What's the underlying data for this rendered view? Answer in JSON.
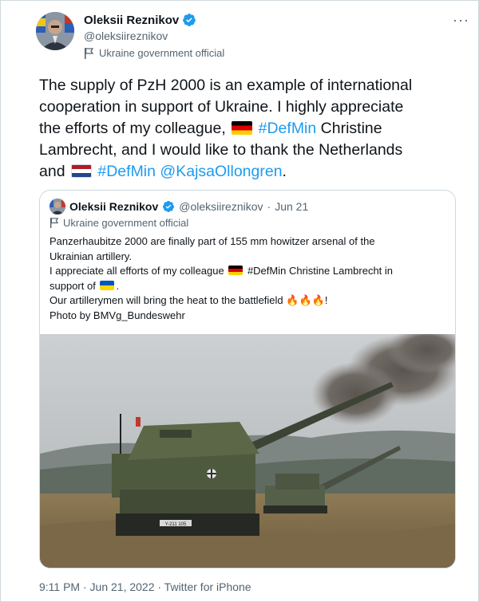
{
  "author": {
    "name": "Oleksii Reznikov",
    "handle": "@oleksiireznikov",
    "label": "Ukraine government official"
  },
  "more_label": "···",
  "tweet": {
    "line1": "The supply of PzH 2000 is an example of international",
    "line2": "cooperation in support of Ukraine. I highly appreciate",
    "line3_pre": "the efforts of my colleague, ",
    "hashtag1": "#DefMin",
    "line3_post": " Christine",
    "line4": "Lambrecht, and I would like to thank the Netherlands",
    "line5_pre": "and ",
    "hashtag2": "#DefMin",
    "mention": "@KajsaOllongren",
    "line5_post": "."
  },
  "quote": {
    "name": "Oleksii Reznikov",
    "handle": "@oleksiireznikov",
    "sep": "·",
    "date": "Jun 21",
    "label": "Ukraine government official",
    "text_line1": "Panzerhaubitze 2000 are finally part of 155 mm howitzer arsenal of the",
    "text_line2": "Ukrainian artillery.",
    "text_line3_pre": "I appreciate all efforts of my colleague ",
    "text_line3_post": " #DefMin Christine Lambrecht in",
    "text_line4": "support of ",
    "text_line4_post": ".",
    "text_line5": "Our artillerymen will bring the heat to the battlefield ",
    "fire": "🔥🔥🔥",
    "text_line5_post": "!",
    "text_line6": "Photo by BMVg_Bundeswehr",
    "photo_plate": "Y-211 105"
  },
  "footer": "9:11 PM · Jun 21, 2022 · Twitter for iPhone",
  "colors": {
    "link": "#1d9bf0",
    "verified": "#1d9bf0",
    "secondary_text": "#536471",
    "border": "#cfd9de"
  },
  "icons": [
    "verified-badge-icon",
    "government-flag-icon",
    "more-icon"
  ]
}
